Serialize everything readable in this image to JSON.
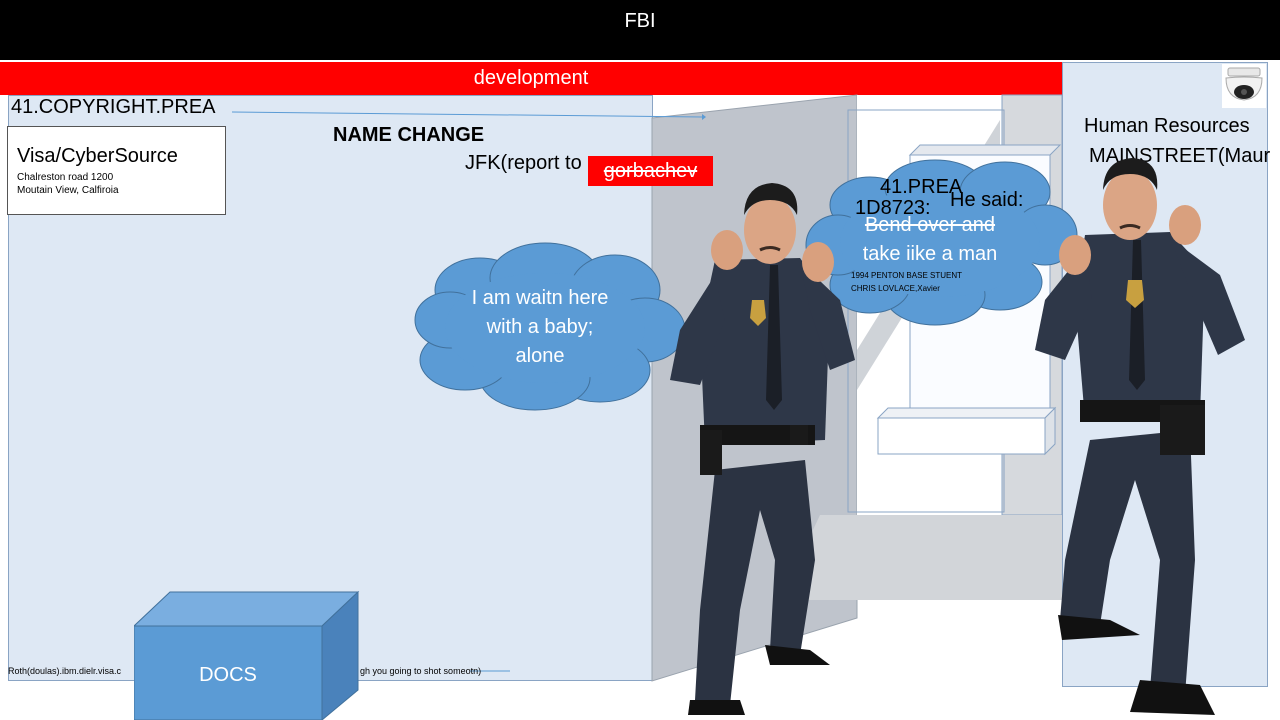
{
  "header": {
    "title": "FBI"
  },
  "banner": {
    "label": "development"
  },
  "left_panel": {
    "heading": "41.COPYRIGHT.PREA",
    "name_change": "NAME CHANGE",
    "jfk_text": "JFK(report to",
    "struck_name": "gorbachev",
    "footer_text_left": "Roth(doulas).ibm.dielr.visa.c",
    "footer_text_right": "gh you going to shot someotn)"
  },
  "visa_box": {
    "title": "Visa/CyberSource",
    "address_line1": "Chalreston road 1200",
    "address_line2": "Moutain View, Calfiroia"
  },
  "bubble_left": {
    "line1": "I am waitn here",
    "line2": "with a baby;",
    "line3": "alone"
  },
  "bubble_right": {
    "prea": "41.PREA",
    "code": "1D8723:",
    "said": "He said:",
    "struck_line": "Bend over and",
    "line2": "take iike a man",
    "small1": "1994 PENTON BASE STUENT",
    "small2": "CHRIS LOVLACE,Xavier"
  },
  "right_panel": {
    "line1": "Human Resources",
    "line2": "MAINSTREET(Maur"
  },
  "docs_box": {
    "label": "DOCS"
  },
  "colors": {
    "header_bg": "#000000",
    "banner_bg": "#ff0000",
    "panel_bg": "#dee8f4",
    "bubble_fill": "#5b9bd5",
    "docs_fill": "#5b9bd5"
  }
}
